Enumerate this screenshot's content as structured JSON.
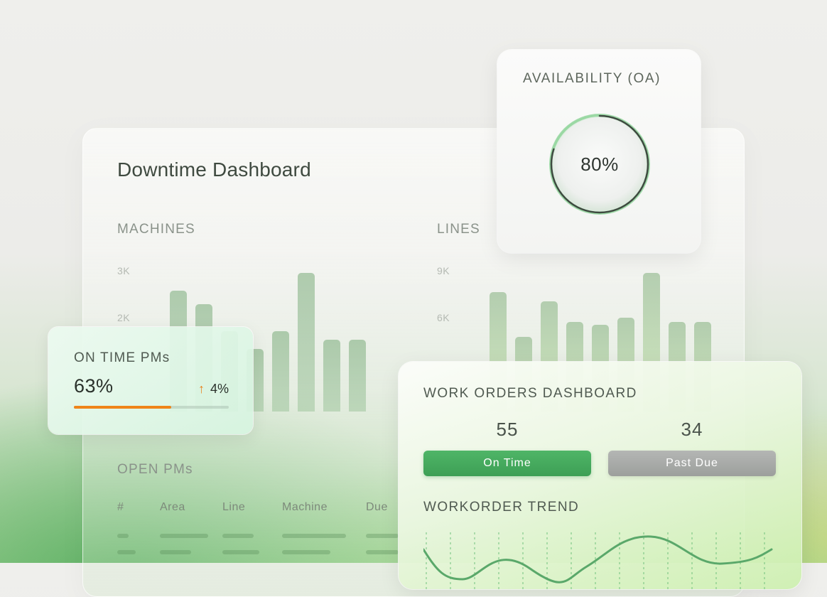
{
  "downtime": {
    "title": "Downtime Dashboard",
    "machines": {
      "label": "MACHINES",
      "ticks": [
        "3K",
        "2K"
      ],
      "bar_values": [
        2.7,
        2.4,
        1.8,
        1.4,
        1.8,
        3.1,
        1.6,
        1.6
      ]
    },
    "lines": {
      "label": "LINES",
      "ticks": [
        "9K",
        "6K"
      ],
      "bar_values": [
        8.0,
        5.0,
        7.4,
        6.0,
        5.8,
        6.3,
        9.3,
        6.0,
        6.0
      ]
    },
    "open_pms": {
      "label": "OPEN PMs",
      "columns": [
        "#",
        "Area",
        "Line",
        "Machine",
        "Due"
      ]
    }
  },
  "availability": {
    "title": "AVAILABILITY (OA)",
    "value_text": "80%",
    "value": 0.8
  },
  "on_time_pms": {
    "title": "ON TIME PMs",
    "value_text": "63%",
    "value": 0.63,
    "change": "4%",
    "change_direction": "up"
  },
  "work_orders": {
    "title": "WORK ORDERS DASHBOARD",
    "on_time": {
      "count": "55",
      "label": "On Time"
    },
    "past_due": {
      "count": "34",
      "label": "Past Due"
    },
    "trend_title": "WORKORDER TREND"
  },
  "colors": {
    "accent_green": "#3d9f55",
    "accent_orange": "#ef8419",
    "gauge_green": "#6cc07a"
  }
}
